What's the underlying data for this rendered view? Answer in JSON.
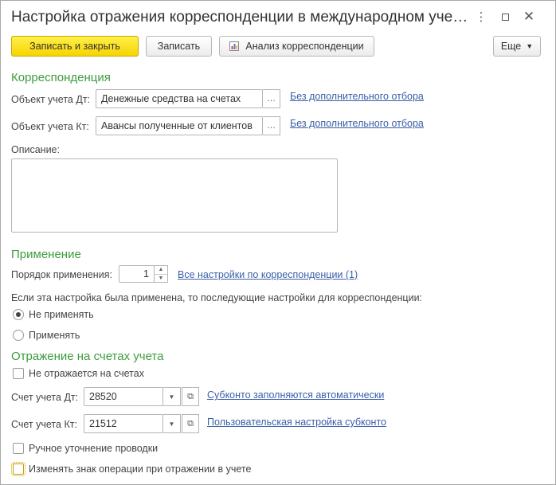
{
  "window": {
    "title": "Настройка отражения корреспонденции в международном уче…"
  },
  "toolbar": {
    "save_close_label": "Записать и закрыть",
    "save_label": "Записать",
    "analysis_label": "Анализ корреспонденции",
    "more_label": "Еще"
  },
  "correspondence": {
    "heading": "Корреспонденция",
    "dt_label": "Объект учета Дт:",
    "dt_value": "Денежные средства на счетах",
    "dt_filter_link": "Без дополнительного отбора",
    "kt_label": "Объект учета Кт:",
    "kt_value": "Авансы полученные от клиентов",
    "kt_filter_link": "Без дополнительного отбора",
    "description_label": "Описание:",
    "description_value": ""
  },
  "application": {
    "heading": "Применение",
    "order_label": "Порядок применения:",
    "order_value": "1",
    "all_settings_link": "Все настройки по корреспонденции (1)",
    "note": "Если эта настройка была применена, то последующие настройки для корреспонденции:",
    "options": [
      {
        "label": "Не применять",
        "selected": true
      },
      {
        "label": "Применять",
        "selected": false
      }
    ]
  },
  "accounts": {
    "heading": "Отражение на счетах учета",
    "not_reflected_label": "Не отражается на счетах",
    "not_reflected_checked": false,
    "dt_label": "Счет учета Дт:",
    "dt_value": "28520",
    "dt_subconto_link": "Субконто заполняются автоматически",
    "kt_label": "Счет учета Кт:",
    "kt_value": "21512",
    "kt_subconto_link": "Пользовательская настройка субконто",
    "manual_label": "Ручное уточнение проводки",
    "manual_checked": false,
    "change_sign_label": "Изменять знак операции при отражении в учете",
    "change_sign_checked": false
  },
  "colors": {
    "section_heading": "#3d9c3d",
    "link": "#3a5fa8",
    "primary_button": "#f5d400"
  }
}
